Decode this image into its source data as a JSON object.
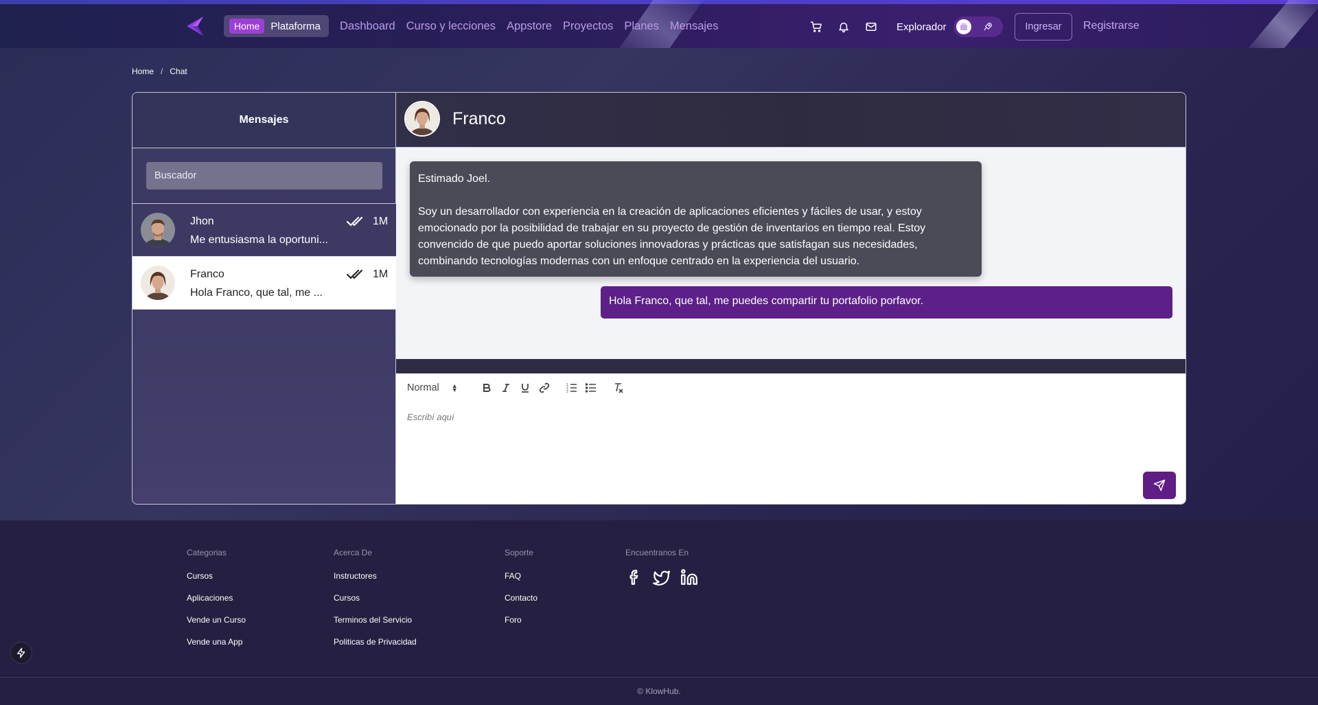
{
  "nav": {
    "home_label": "Home",
    "platform_label": "Plataforma",
    "links": [
      "Dashboard",
      "Curso y lecciones",
      "Appstore",
      "Proyectos",
      "Planes",
      "Mensajes"
    ],
    "explorador_label": "Explorador",
    "login_label": "Ingresar",
    "register_label": "Registrarse"
  },
  "breadcrumb": {
    "home": "Home",
    "separator": "/",
    "current": "Chat"
  },
  "sidebar": {
    "title": "Mensajes",
    "search_placeholder": "Buscador",
    "contacts": [
      {
        "name": "Jhon",
        "preview": "Me entusiasma la oportuni...",
        "time": "1M",
        "active": false
      },
      {
        "name": "Franco",
        "preview": "Hola Franco, que tal, me ...",
        "time": "1M",
        "active": true
      }
    ]
  },
  "chat": {
    "contact_name": "Franco",
    "messages": [
      {
        "direction": "incoming",
        "greeting": "Estimado Joel.",
        "body": "Soy un desarrollador con experiencia en la creación de aplicaciones eficientes y fáciles de usar, y estoy emocionado por la posibilidad de trabajar en su proyecto de gestión de inventarios en tiempo real. Estoy convencido de que puedo aportar soluciones innovadoras y prácticas que satisfagan sus necesidades, combinando tecnologías modernas con un enfoque centrado en la experiencia del usuario."
      },
      {
        "direction": "outgoing",
        "body": "Hola Franco, que tal, me puedes compartir tu portafolio porfavor."
      }
    ]
  },
  "editor": {
    "format_value": "Normal",
    "placeholder": "Escribí aquí",
    "toolbar_icons": [
      "bold-icon",
      "italic-icon",
      "underline-icon",
      "link-icon",
      "ordered-list-icon",
      "bullet-list-icon",
      "clear-format-icon"
    ]
  },
  "footer": {
    "columns": [
      {
        "heading": "Categorias",
        "links": [
          "Cursos",
          "Aplicaciones",
          "Vende un Curso",
          "Vende una App"
        ]
      },
      {
        "heading": "Acerca De",
        "links": [
          "Instructores",
          "Cursos",
          "Terminos del Servicio",
          "Politicas de Privacidad"
        ]
      },
      {
        "heading": "Soporte",
        "links": [
          "FAQ",
          "Contacto",
          "Foro"
        ]
      },
      {
        "heading": "Encuentranos En",
        "social": [
          "facebook-icon",
          "twitter-icon",
          "linkedin-icon"
        ]
      }
    ],
    "copyright": "© KlowHub."
  },
  "colors": {
    "accent_purple": "#5f1d86",
    "home_pill": "#9b3fd6",
    "nav_link": "#b89be8",
    "outgoing_bubble": "#5c2088",
    "incoming_bubble": "#4a4b57"
  }
}
